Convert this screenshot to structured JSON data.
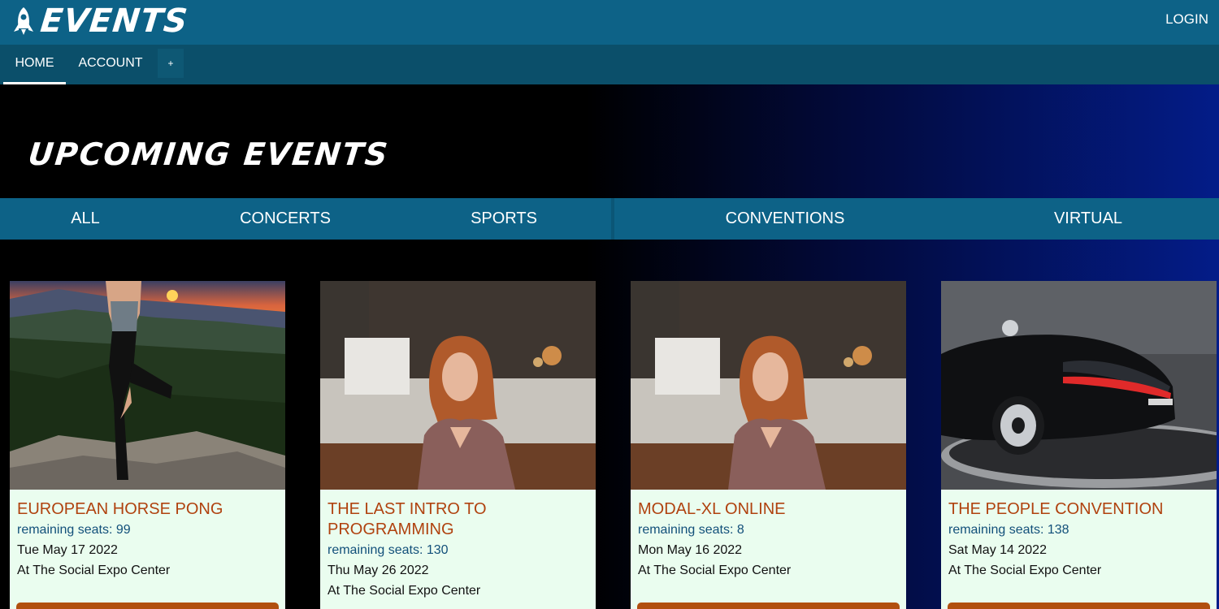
{
  "header": {
    "logo_text": "EVENTS",
    "logo_icon": "rocket-icon",
    "login_label": "LOGIN"
  },
  "nav": {
    "items": [
      {
        "label": "HOME",
        "active": true
      },
      {
        "label": "ACCOUNT",
        "active": false
      },
      {
        "label": "+",
        "active": false
      }
    ]
  },
  "hero": {
    "title": "UPCOMING EVENTS"
  },
  "filters": [
    {
      "label": "ALL"
    },
    {
      "label": "CONCERTS"
    },
    {
      "label": "SPORTS"
    },
    {
      "label": "CONVENTIONS"
    },
    {
      "label": "VIRTUAL"
    }
  ],
  "events": [
    {
      "title": "EUROPEAN HORSE PONG",
      "seats": "remaining seats: 99",
      "date": "Tue May 17 2022",
      "venue": "At The Social Expo Center",
      "image": "yoga-sunset-photo"
    },
    {
      "title": "THE LAST INTRO TO PROGRAMMING",
      "seats": "remaining seats: 130",
      "date": "Thu May 26 2022",
      "venue": "At The Social Expo Center",
      "image": "woman-cafe-photo"
    },
    {
      "title": "MODAL-XL ONLINE",
      "seats": "remaining seats: 8",
      "date": "Mon May 16 2022",
      "venue": "At The Social Expo Center",
      "image": "woman-cafe-photo"
    },
    {
      "title": "THE PEOPLE CONVENTION",
      "seats": "remaining seats: 138",
      "date": "Sat May 14 2022",
      "venue": "At The Social Expo Center",
      "image": "sports-car-photo"
    }
  ],
  "colors": {
    "header_bg": "#0d6287",
    "nav_bg": "#0b4f6a",
    "card_bg": "#eafdef",
    "card_title": "#b0420f",
    "card_seats": "#12507a",
    "card_button": "#b14f0f"
  }
}
